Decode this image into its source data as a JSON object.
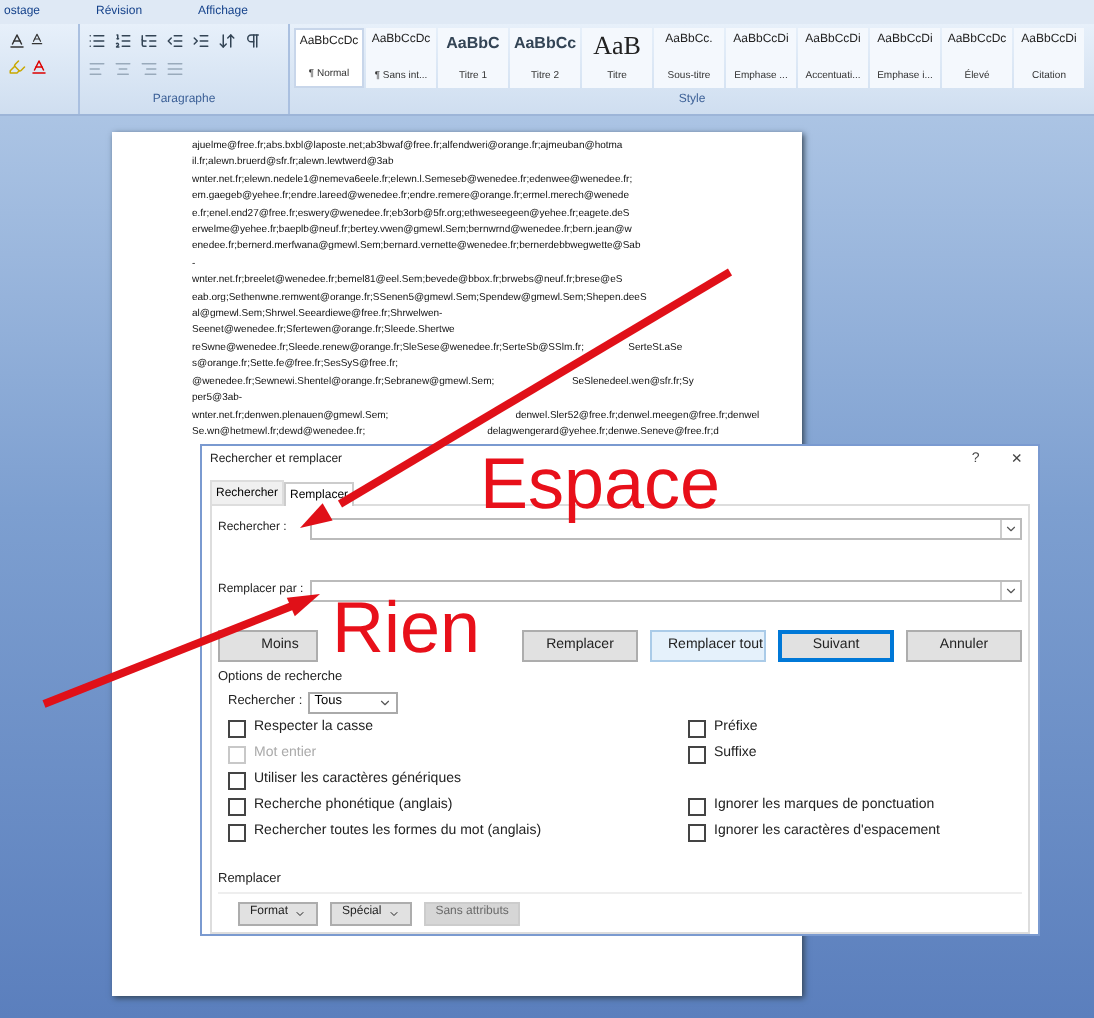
{
  "menu_tabs": [
    {
      "label": "ostage",
      "selected": false
    },
    {
      "label": "Révision",
      "selected": false
    },
    {
      "label": "Affichage",
      "selected": false
    }
  ],
  "ribbon": {
    "groups": [
      {
        "label": "Paragraphe"
      },
      {
        "label": "Style"
      }
    ],
    "styles": [
      {
        "preview": "AaBbCcDc",
        "label": "¶ Normal",
        "selected": true
      },
      {
        "preview": "AaBbCcDc",
        "label": "¶ Sans int...",
        "selected": false
      },
      {
        "preview": "AaBbC",
        "label": "Titre 1",
        "selected": false
      },
      {
        "preview": "AaBbCc",
        "label": "Titre 2",
        "selected": false
      },
      {
        "preview": "AaB",
        "label": "Titre",
        "selected": false
      },
      {
        "preview": "AaBbCc.",
        "label": "Sous-titre",
        "selected": false
      },
      {
        "preview": "AaBbCcDi",
        "label": "Emphase ...",
        "selected": false
      },
      {
        "preview": "AaBbCcDi",
        "label": "Accentuati...",
        "selected": false
      },
      {
        "preview": "AaBbCcDi",
        "label": "Emphase i...",
        "selected": false
      },
      {
        "preview": "AaBbCcDc",
        "label": "Élevé",
        "selected": false
      },
      {
        "preview": "AaBbCcDi",
        "label": "Citation",
        "selected": false
      }
    ]
  },
  "document": {
    "lines": [
      {
        "parts": [
          "ajuelme@free.fr;abs.bxbl@laposte.net;ab3bwaf@free.fr;alfendweri@orange.fr;ajmeuban@hotma"
        ]
      },
      {
        "parts": [
          "il.fr;alewn.bruerd@sfr.fr;alewn.lewtwerd@3ab"
        ]
      },
      {
        "parts": [
          "wnter.net.fr;elewn.nedele1@nemeva6eele.fr;elewn.l.Semeseb@wenedee.fr;edenwee@wenedee.fr;"
        ]
      },
      {
        "parts": [
          "em.gaegeb@yehee.fr;endre.lareed@wenedee.fr;endre.remere@orange.fr;ermel.merech@wenede"
        ]
      },
      {
        "parts": [
          "e.fr;enel.end27@free.fr;eswery@wenedee.fr;eb3orb@5fr.org;ethweseegeen@yehee.fr;eagete.deS"
        ]
      },
      {
        "parts": [
          "erwelme@yehee.fr;baeplb@neuf.fr;bertey.vwen@gmewl.Sem;bernwrnd@wenedee.fr;bern.jean@w"
        ]
      },
      {
        "parts": [
          "enedee.fr;bernerd.merfwana@gmewl.Sem;bernard.vernette@wenedee.fr;bernerdebbwegwette@Sab"
        ]
      },
      {
        "parts": [
          "-"
        ]
      },
      {
        "parts": [
          "wnter.net.fr;breelet@wenedee.fr;bemel81@eel.Sem;bevede@bbox.fr;brwebs@neuf.fr;brese@eS"
        ]
      },
      {
        "parts": [
          "eab.org;Sethenwne.remwent@orange.fr;SSenen5@gmewl.Sem;Spendew@gmewl.Sem;Shepen.deeS"
        ]
      },
      {
        "parts": [
          "al@gmewl.Sem;Shrwel.Seeardiewe@free.fr;Shrwelwen-"
        ]
      },
      {
        "parts": [
          "Seenet@wenedee.fr;Sfertewen@orange.fr;Sleede.Shertwe"
        ]
      },
      {
        "parts": [
          "reSwne@wenedee.fr;Sleede.renew@orange.fr;SleSese@wenedee.fr;SerteSb@SSlm.fr;",
          "SerteSt.aSe"
        ]
      },
      {
        "parts": [
          "s@orange.fr;Sette.fe@free.fr;SesSyS@free.fr;"
        ]
      },
      {
        "parts": [
          "@wenedee.fr;Sewnewi.Shentel@orange.fr;Sebranew@gmewl.Sem;",
          "SeSlenedeel.wen@sfr.fr;Sy"
        ]
      },
      {
        "parts": [
          "per5@3ab-"
        ]
      },
      {
        "parts": [
          "wnter.net.fr;denwen.plenauen@gmewl.Sem;",
          "denwel.Sler52@free.fr;denwel.meegen@free.fr;denwel"
        ]
      },
      {
        "parts": [
          "Se.wn@hetmewl.fr;dewd@wenedee.fr;",
          "delagwengerard@yehee.fr;denwe.Seneve@free.fr;d"
        ]
      }
    ]
  },
  "annotations": [
    {
      "text": "Espace"
    },
    {
      "text": "Rien"
    }
  ],
  "dialog": {
    "title": "Rechercher et remplacer",
    "help": "?",
    "close": "×",
    "tabs": [
      {
        "label": "Rechercher",
        "selected": false
      },
      {
        "label": "Remplacer",
        "selected": true
      }
    ],
    "fields": [
      {
        "label": "Rechercher :"
      },
      {
        "label": "Remplacer par :"
      }
    ],
    "buttons": [
      {
        "label": "Moins",
        "kind": "normal"
      },
      {
        "label": "Remplacer",
        "kind": "normal"
      },
      {
        "label": "Remplacer tout",
        "kind": "hover"
      },
      {
        "label": "Suivant",
        "kind": "default"
      },
      {
        "label": "Annuler",
        "kind": "normal"
      }
    ],
    "options_title": "Options de recherche",
    "search_scope": {
      "label": "Rechercher :",
      "value": "Tous"
    },
    "left_options": [
      {
        "label": "Respecter la casse",
        "checked": false,
        "disabled": false
      },
      {
        "label": "Mot entier",
        "checked": false,
        "disabled": true
      },
      {
        "label": "Utiliser les caractères génériques",
        "checked": false,
        "disabled": false
      },
      {
        "label": "Recherche phonétique (anglais)",
        "checked": false,
        "disabled": false
      },
      {
        "label": "Rechercher toutes les formes du mot (anglais)",
        "checked": false,
        "disabled": false
      }
    ],
    "right_options": [
      {
        "label": "Préfixe",
        "checked": false,
        "disabled": false
      },
      {
        "label": "Suffixe",
        "checked": false,
        "disabled": false
      },
      {
        "label": "Ignorer les marques de ponctuation",
        "checked": false,
        "disabled": false
      },
      {
        "label": "Ignorer les caractères d'espacement",
        "checked": false,
        "disabled": false
      }
    ],
    "replace_title": "Remplacer",
    "replace_buttons": [
      {
        "label": "Format",
        "dropdown": true,
        "disabled": false
      },
      {
        "label": "Spécial",
        "dropdown": true,
        "disabled": false
      },
      {
        "label": "Sans attributs",
        "dropdown": false,
        "disabled": true
      }
    ]
  }
}
